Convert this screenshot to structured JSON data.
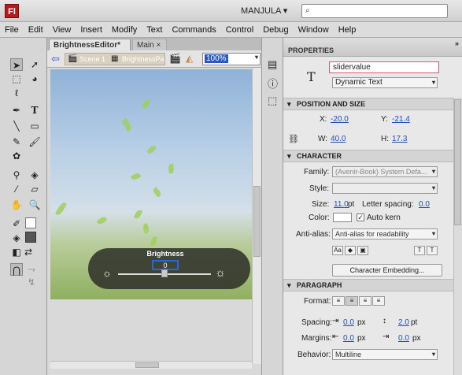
{
  "app": {
    "logo": "Fl",
    "workspace": "MANJULA ▾"
  },
  "menu": [
    "File",
    "Edit",
    "View",
    "Insert",
    "Modify",
    "Text",
    "Commands",
    "Control",
    "Debug",
    "Window",
    "Help"
  ],
  "doc_tabs": [
    {
      "label": "BrightnessEditor*"
    },
    {
      "label": "Main"
    }
  ],
  "edit_bar": {
    "scene": "Scene 1",
    "symbol": "BrightnessPa",
    "zoom": "100%"
  },
  "stage": {
    "title": "Brightness",
    "value": "0"
  },
  "properties": {
    "tab": "PROPERTIES",
    "instance_name": "slidervalue",
    "text_type": "Dynamic Text",
    "position_size": {
      "title": "POSITION AND SIZE",
      "x_label": "X:",
      "x": "-20.0",
      "y_label": "Y:",
      "y": "-21.4",
      "w_label": "W:",
      "w": "40.0",
      "h_label": "H:",
      "h": "17.3"
    },
    "character": {
      "title": "CHARACTER",
      "family_label": "Family:",
      "family": "(Avenir-Book) System Defa...",
      "style_label": "Style:",
      "size_label": "Size:",
      "size": "11.0",
      "size_unit": "pt",
      "spacing_label": "Letter spacing:",
      "spacing": "0.0",
      "color_label": "Color:",
      "autokern": "Auto kern",
      "antialias_label": "Anti-alias:",
      "antialias": "Anti-alias for readability",
      "embed_button": "Character Embedding..."
    },
    "paragraph": {
      "title": "PARAGRAPH",
      "format_label": "Format:",
      "spacing_label": "Spacing:",
      "spacing1": "0.0",
      "spacing1_unit": "px",
      "spacing2": "2.0",
      "spacing2_unit": "pt",
      "margins_label": "Margins:",
      "margin1": "0.0",
      "margin1_unit": "px",
      "margin2": "0.0",
      "margin2_unit": "px",
      "behavior_label": "Behavior:",
      "behavior": "Multiline"
    }
  }
}
